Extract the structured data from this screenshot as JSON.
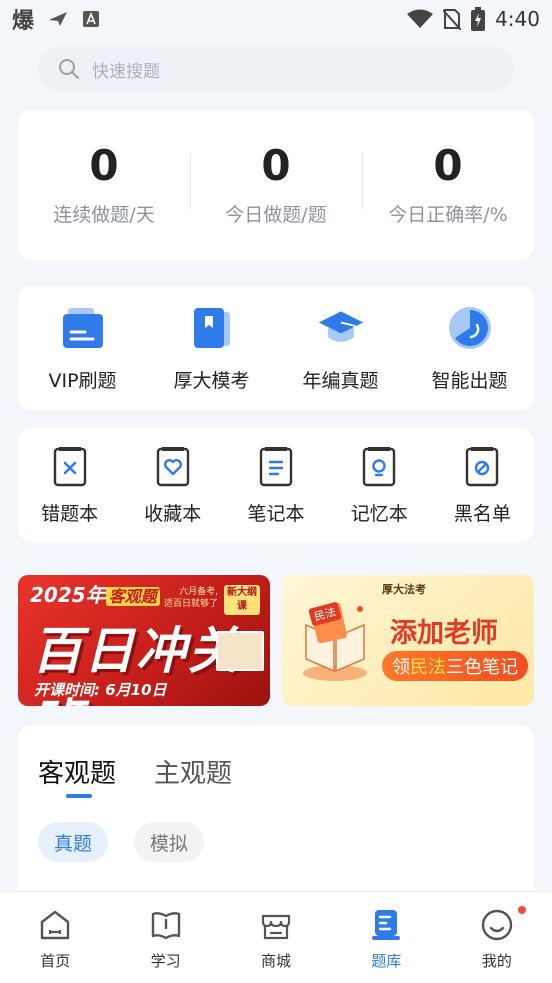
{
  "status_bar": {
    "left_glyph": "爆",
    "time": "4:40",
    "icons": [
      "send-icon",
      "a-box-icon",
      "wifi-icon",
      "no-sim-icon",
      "battery-charging-icon"
    ]
  },
  "search": {
    "placeholder": "快速搜题"
  },
  "stats": [
    {
      "value": "0",
      "label": "连续做题/天"
    },
    {
      "value": "0",
      "label": "今日做题/题"
    },
    {
      "value": "0",
      "label": "今日正确率/%"
    }
  ],
  "features": [
    {
      "label": "VIP刷题",
      "icon": "vip-card-icon"
    },
    {
      "label": "厚大模考",
      "icon": "bookmark-book-icon"
    },
    {
      "label": "年编真题",
      "icon": "graduation-cap-icon"
    },
    {
      "label": "智能出题",
      "icon": "pie-chart-icon"
    }
  ],
  "tools": [
    {
      "label": "错题本",
      "icon": "wrong-book-icon"
    },
    {
      "label": "收藏本",
      "icon": "favorite-book-icon"
    },
    {
      "label": "笔记本",
      "icon": "notes-book-icon"
    },
    {
      "label": "记忆本",
      "icon": "memory-book-icon"
    },
    {
      "label": "黑名单",
      "icon": "blacklist-book-icon"
    }
  ],
  "banners": {
    "left": {
      "year": "2025年",
      "tag": "客观题",
      "title": "百日冲关班",
      "sub_line1": "六月备考,",
      "sub_line2": "适百日就够了",
      "badge": "新大纲课",
      "date": "开课时间: 6月10日"
    },
    "right": {
      "logo": "厚大法考",
      "title": "添加老师",
      "sub_prefix": "领",
      "sub_highlight": "民法",
      "sub_suffix": "三色笔记",
      "tag": "民法"
    }
  },
  "subject_tabs": [
    {
      "label": "客观题",
      "active": true
    },
    {
      "label": "主观题",
      "active": false
    }
  ],
  "chips": [
    {
      "label": "真题",
      "active": true
    },
    {
      "label": "模拟",
      "active": false
    }
  ],
  "nav": [
    {
      "label": "首页",
      "icon": "home-icon",
      "active": false
    },
    {
      "label": "学习",
      "icon": "study-book-icon",
      "active": false
    },
    {
      "label": "商城",
      "icon": "store-icon",
      "active": false
    },
    {
      "label": "题库",
      "icon": "question-bank-icon",
      "active": true
    },
    {
      "label": "我的",
      "icon": "smiley-profile-icon",
      "active": false
    }
  ],
  "colors": {
    "accent": "#2f7bea",
    "background": "#f3f6fb",
    "notification": "#f24c3d"
  }
}
